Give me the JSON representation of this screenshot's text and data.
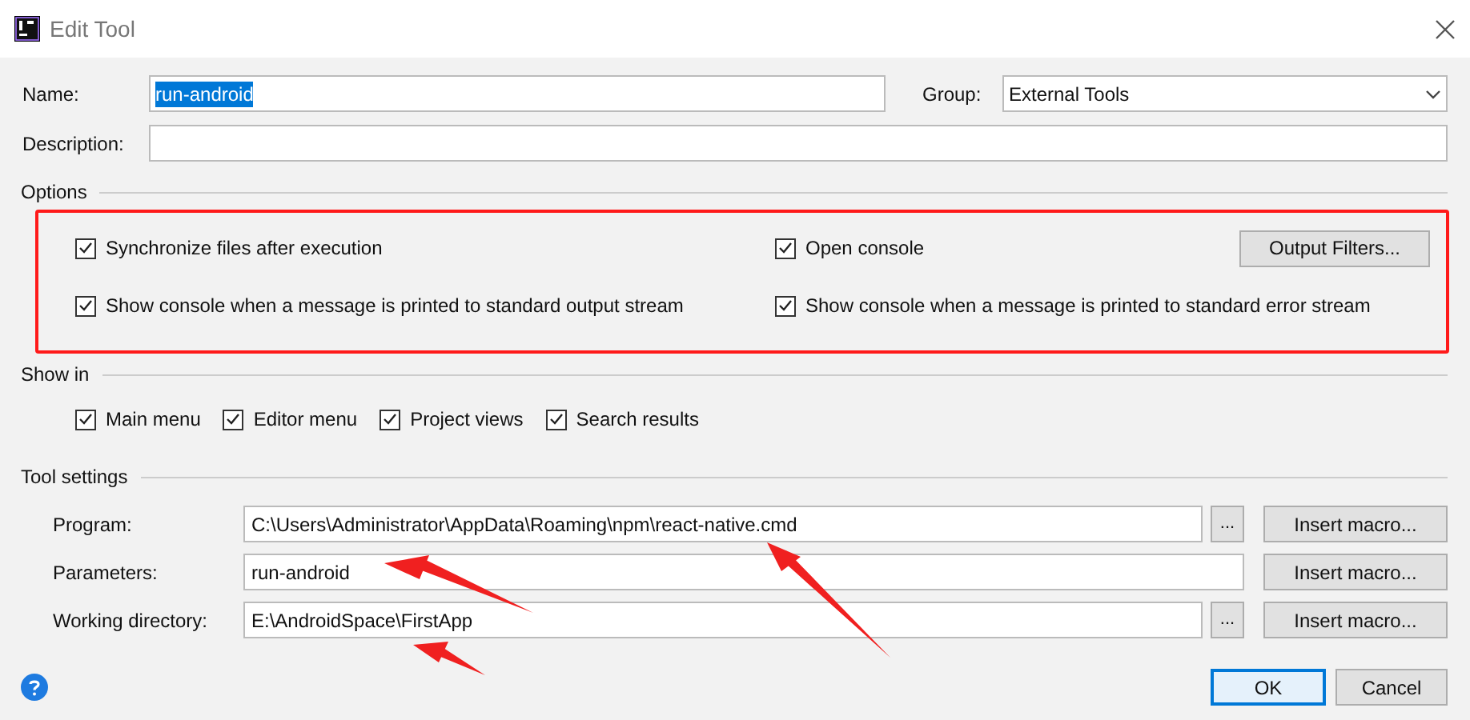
{
  "window": {
    "title": "Edit Tool"
  },
  "name": {
    "label": "Name:",
    "value": "run-android",
    "text_selected": true
  },
  "group": {
    "label": "Group:",
    "value": "External Tools"
  },
  "description": {
    "label": "Description:"
  },
  "options": {
    "title": "Options",
    "checkboxes": [
      {
        "label": "Synchronize files after execution",
        "checked": true
      },
      {
        "label": "Open console",
        "checked": true
      },
      {
        "label": "Show console when a message is printed to standard output stream",
        "checked": true
      },
      {
        "label": "Show console when a message is printed to standard error stream",
        "checked": true
      }
    ],
    "button": "Output Filters..."
  },
  "show_in": {
    "title": "Show in",
    "checkboxes": [
      {
        "label": "Main menu",
        "checked": true
      },
      {
        "label": "Editor menu",
        "checked": true
      },
      {
        "label": "Project views",
        "checked": true
      },
      {
        "label": "Search results",
        "checked": true
      }
    ]
  },
  "tool_settings": {
    "title": "Tool settings",
    "rows": [
      {
        "label": "Program:",
        "value": "C:\\Users\\Administrator\\AppData\\Roaming\\npm\\react-native.cmd",
        "browse": "...",
        "macro": "Insert macro..."
      },
      {
        "label": "Parameters:",
        "value": "run-android",
        "macro": "Insert macro..."
      },
      {
        "label": "Working directory:",
        "value": "E:\\AndroidSpace\\FirstApp",
        "browse": "...",
        "macro": "Insert macro..."
      }
    ]
  },
  "buttons": [
    {
      "label": "OK",
      "default": true
    },
    {
      "label": "Cancel",
      "default": false
    }
  ]
}
